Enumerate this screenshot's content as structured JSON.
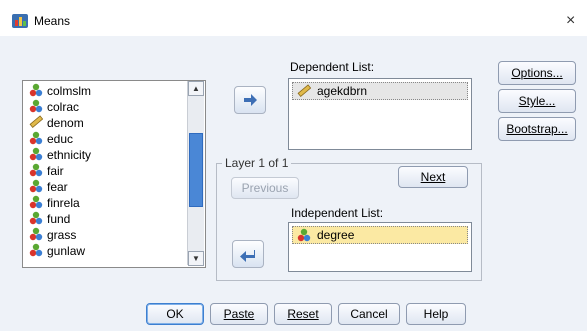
{
  "window": {
    "title": "Means",
    "close_glyph": "×"
  },
  "source_list": {
    "items": [
      {
        "label": "colmslm",
        "icon": "nominal-variable-icon"
      },
      {
        "label": "colrac",
        "icon": "nominal-variable-icon"
      },
      {
        "label": "denom",
        "icon": "scale-variable-icon"
      },
      {
        "label": "educ",
        "icon": "nominal-variable-icon"
      },
      {
        "label": "ethnicity",
        "icon": "nominal-variable-icon"
      },
      {
        "label": "fair",
        "icon": "nominal-variable-icon"
      },
      {
        "label": "fear",
        "icon": "nominal-variable-icon"
      },
      {
        "label": "finrela",
        "icon": "nominal-variable-icon"
      },
      {
        "label": "fund",
        "icon": "nominal-variable-icon"
      },
      {
        "label": "grass",
        "icon": "nominal-variable-icon"
      },
      {
        "label": "gunlaw",
        "icon": "nominal-variable-icon"
      }
    ]
  },
  "dependent": {
    "label": "Dependent List:",
    "items": [
      {
        "label": "agekdbrn",
        "icon": "scale-variable-icon"
      }
    ]
  },
  "layer": {
    "label": "Layer 1 of 1",
    "previous_label": "Previous",
    "next_label": "Next"
  },
  "independent": {
    "label": "Independent List:",
    "items": [
      {
        "label": "degree",
        "icon": "nominal-variable-icon"
      }
    ]
  },
  "side_buttons": {
    "options": "Options...",
    "style": "Style...",
    "bootstrap": "Bootstrap..."
  },
  "bottom_buttons": {
    "ok": "OK",
    "paste": "Paste",
    "reset": "Reset",
    "cancel": "Cancel",
    "help": "Help"
  },
  "colors": {
    "accent_blue": "#2f6bbf",
    "highlight_yellow": "#fbe9a3",
    "dialog_bg": "#eef2f8"
  }
}
